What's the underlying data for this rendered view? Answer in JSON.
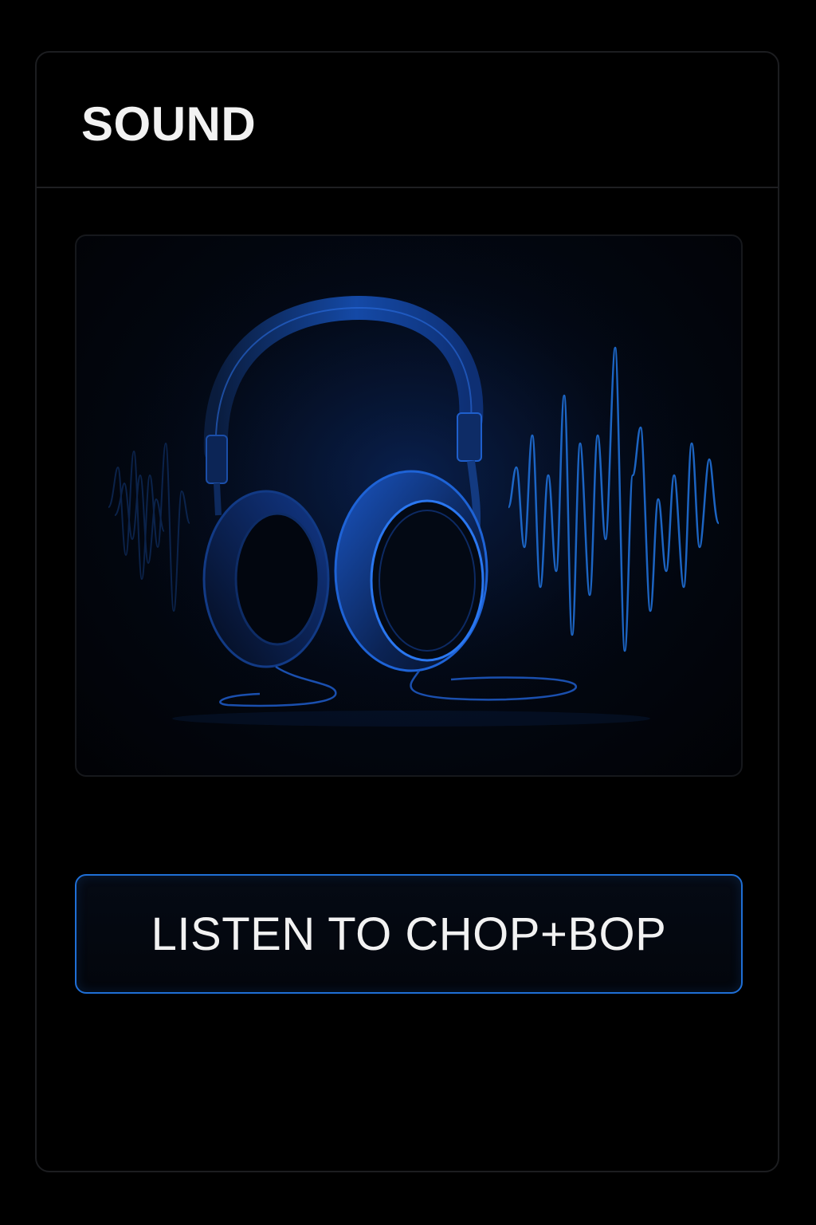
{
  "header": {
    "title": "SOUND"
  },
  "hero": {
    "icon": "headphones-icon",
    "decoration": "sound-wave"
  },
  "cta": {
    "label": "LISTEN TO CHOP+BOP"
  },
  "colors": {
    "background": "#000000",
    "accent": "#1f6fd6",
    "text": "#f2f2f2",
    "border": "#1c1d20"
  }
}
